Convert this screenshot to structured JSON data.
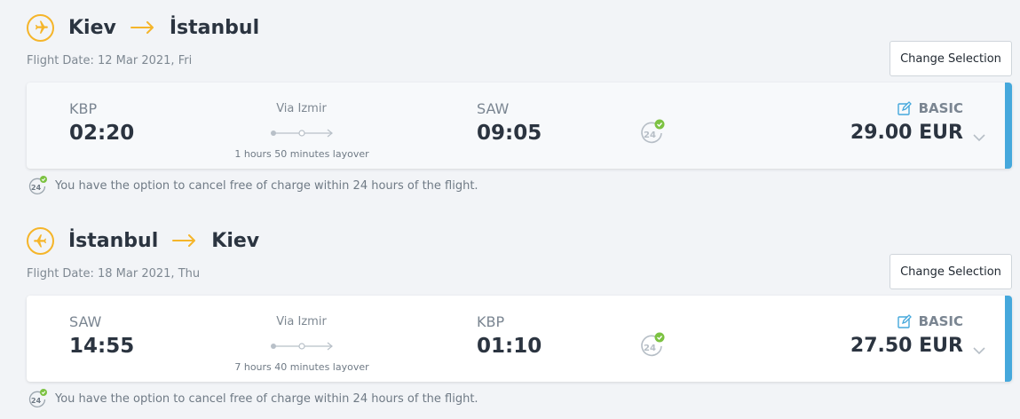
{
  "legs": [
    {
      "origin_city": "Kiev",
      "destination_city": "İstanbul",
      "flight_date": "Flight Date: 12 Mar 2021, Fri",
      "change_button": "Change Selection",
      "departure_code": "KBP",
      "departure_time": "02:20",
      "via": "Via Izmir",
      "layover": "1 hours 50 minutes layover",
      "arrival_code": "SAW",
      "arrival_time": "09:05",
      "fare_class": "BASIC",
      "price": "29.00 EUR",
      "cancel_note": "You have the option to cancel free of charge within 24 hours of the flight."
    },
    {
      "origin_city": "İstanbul",
      "destination_city": "Kiev",
      "flight_date": "Flight Date: 18 Mar 2021, Thu",
      "change_button": "Change Selection",
      "departure_code": "SAW",
      "departure_time": "14:55",
      "via": "Via Izmir",
      "layover": "7 hours 40 minutes layover",
      "arrival_code": "KBP",
      "arrival_time": "01:10",
      "fare_class": "BASIC",
      "price": "27.50 EUR",
      "cancel_note": "You have the option to cancel free of charge within 24 hours of the flight."
    }
  ],
  "colors": {
    "accent_yellow": "#f5b52a",
    "accent_blue": "#45a8dc",
    "check_green": "#7cc242"
  },
  "icons": {
    "plane": "airplane-icon",
    "arrow": "arrow-right-icon",
    "cancel24": "free-cancel-24h-icon",
    "edit": "edit-icon",
    "chevron": "chevron-down-icon"
  }
}
